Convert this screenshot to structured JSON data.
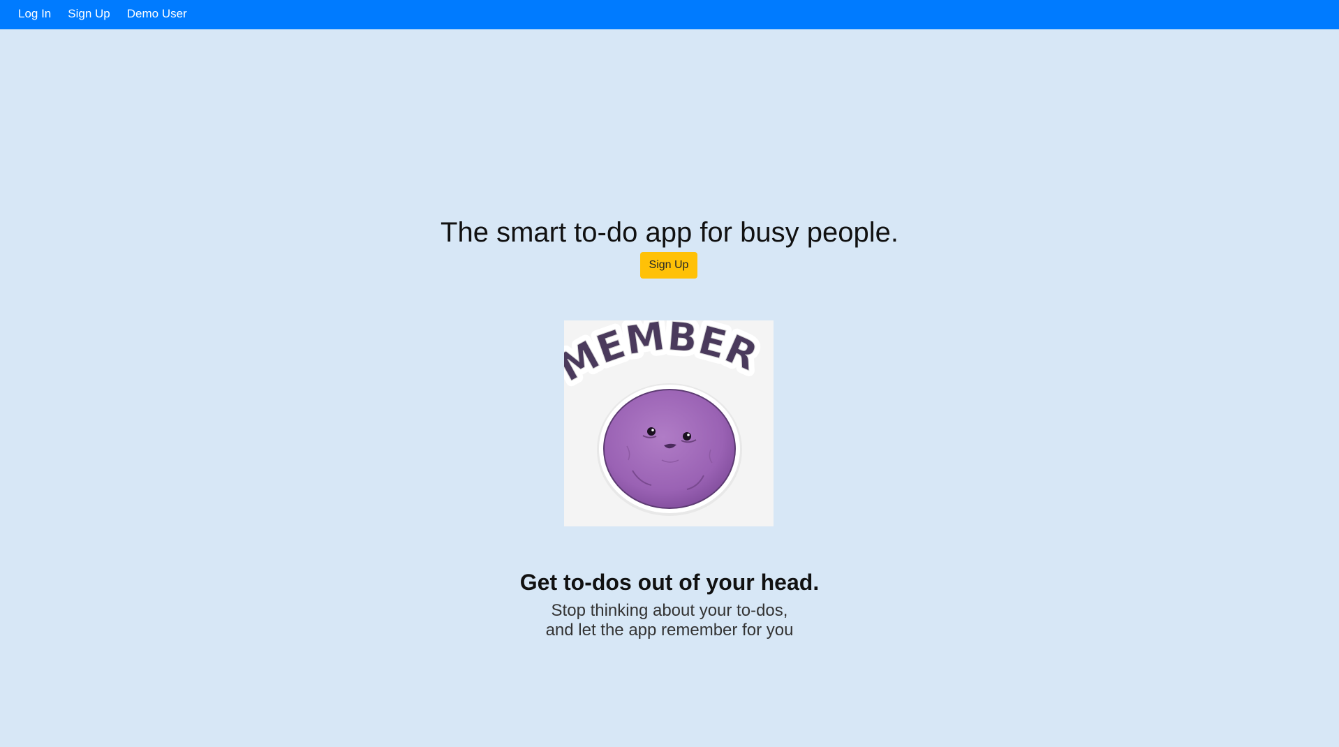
{
  "nav": {
    "items": [
      {
        "label": "Log In"
      },
      {
        "label": "Sign Up"
      },
      {
        "label": "Demo User"
      }
    ],
    "color": "#007bff"
  },
  "hero": {
    "headline": "The smart to-do app for busy people.",
    "cta_label": "Sign Up",
    "cta_color": "#ffc107",
    "image": {
      "sticker_text": "MEMBER?",
      "description_icon": "member-berry-sticker"
    }
  },
  "feature": {
    "title": "Get to-dos out of your head.",
    "line1": "Stop thinking about your to-dos,",
    "line2": "and let the app remember for you"
  },
  "background_color": "#d7e7f6"
}
